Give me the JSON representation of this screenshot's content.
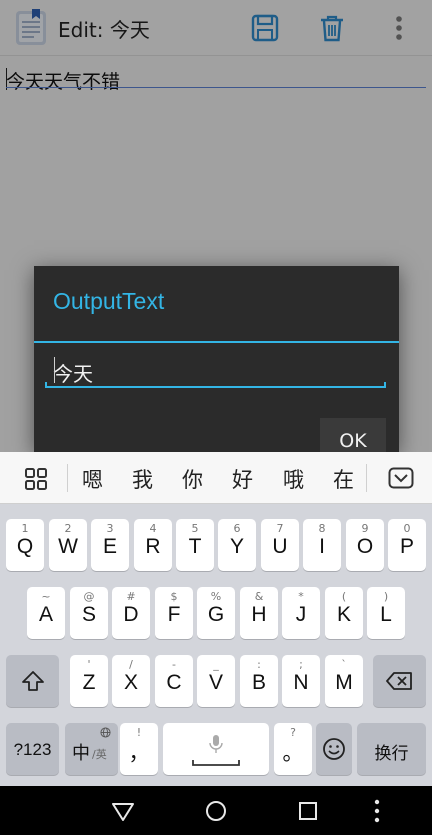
{
  "app": {
    "title": "Edit: 今天",
    "note_text": "今天天气不错",
    "icons": [
      "notepad-icon",
      "save-icon",
      "delete-icon",
      "overflow-menu-icon"
    ]
  },
  "dialog": {
    "title": "OutputText",
    "input_value": "今天",
    "ok_label": "OK",
    "accent": "#33b5e5"
  },
  "keyboard": {
    "candidates": [
      "嗯",
      "我",
      "你",
      "好",
      "哦",
      "在"
    ],
    "row1": [
      {
        "main": "Q",
        "sub": "1"
      },
      {
        "main": "W",
        "sub": "2"
      },
      {
        "main": "E",
        "sub": "3"
      },
      {
        "main": "R",
        "sub": "4"
      },
      {
        "main": "T",
        "sub": "5"
      },
      {
        "main": "Y",
        "sub": "6"
      },
      {
        "main": "U",
        "sub": "7"
      },
      {
        "main": "I",
        "sub": "8"
      },
      {
        "main": "O",
        "sub": "9"
      },
      {
        "main": "P",
        "sub": "0"
      }
    ],
    "row2": [
      {
        "main": "A",
        "sub": "~"
      },
      {
        "main": "S",
        "sub": "@"
      },
      {
        "main": "D",
        "sub": "#"
      },
      {
        "main": "F",
        "sub": "$"
      },
      {
        "main": "G",
        "sub": "%"
      },
      {
        "main": "H",
        "sub": "&"
      },
      {
        "main": "J",
        "sub": "*"
      },
      {
        "main": "K",
        "sub": "("
      },
      {
        "main": "L",
        "sub": ")"
      }
    ],
    "row3": [
      {
        "main": "Z",
        "sub": "'"
      },
      {
        "main": "X",
        "sub": "/"
      },
      {
        "main": "C",
        "sub": "-"
      },
      {
        "main": "V",
        "sub": "_"
      },
      {
        "main": "B",
        "sub": ":"
      },
      {
        "main": "N",
        "sub": ";"
      },
      {
        "main": "M",
        "sub": "`"
      }
    ],
    "num_label": "?123",
    "lang_main": "中",
    "lang_sub": "/英",
    "comma_main": "，",
    "comma_sub": "!",
    "period_main": "。",
    "period_sub": "?",
    "enter_label": "换行"
  }
}
